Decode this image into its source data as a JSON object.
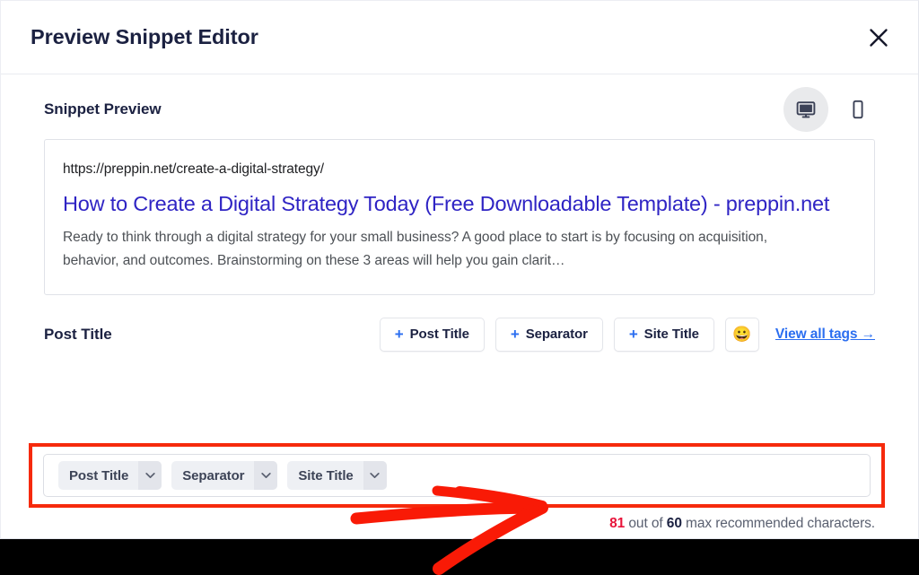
{
  "window": {
    "title": "Preview Snippet Editor",
    "close_icon": "close-icon"
  },
  "preview_section": {
    "heading": "Snippet Preview",
    "device_toggle": {
      "desktop": {
        "icon": "desktop-monitor-icon",
        "label": "Desktop",
        "active": true
      },
      "mobile": {
        "icon": "mobile-phone-icon",
        "label": "Mobile",
        "active": false
      }
    },
    "snippet": {
      "url": "https://preppin.net/create-a-digital-strategy/",
      "title": "How to Create a Digital Strategy Today (Free Downloadable Template) - preppin.net",
      "description": "Ready to think through a digital strategy for your small business? A good place to start is by focusing on acquisition, behavior, and outcomes. Brainstorming on these 3 areas will help you gain clarit…"
    }
  },
  "title_field": {
    "label": "Post Title",
    "actions": [
      {
        "plus": "+",
        "label": "Post Title"
      },
      {
        "plus": "+",
        "label": "Separator"
      },
      {
        "plus": "+",
        "label": "Site Title"
      }
    ],
    "emoji_button": "😀",
    "view_all_tags": "View all tags →",
    "tokens": [
      {
        "label": "Post Title",
        "caret": "chevron-down-icon"
      },
      {
        "label": "Separator",
        "caret": "chevron-down-icon"
      },
      {
        "label": "Site Title",
        "caret": "chevron-down-icon"
      }
    ],
    "counter": {
      "current": "81",
      "middle": " out of ",
      "max": "60",
      "suffix": " max recommended characters."
    }
  },
  "annotation": {
    "arrow": "red-arrow-annotation",
    "color": "#f91a06"
  },
  "colors": {
    "accent_blue": "#2b6ef0",
    "link_purple": "#2f24c4",
    "highlight_red": "#f62a0c",
    "over_limit_red": "#e8143a",
    "heading_navy": "#1b2141"
  }
}
